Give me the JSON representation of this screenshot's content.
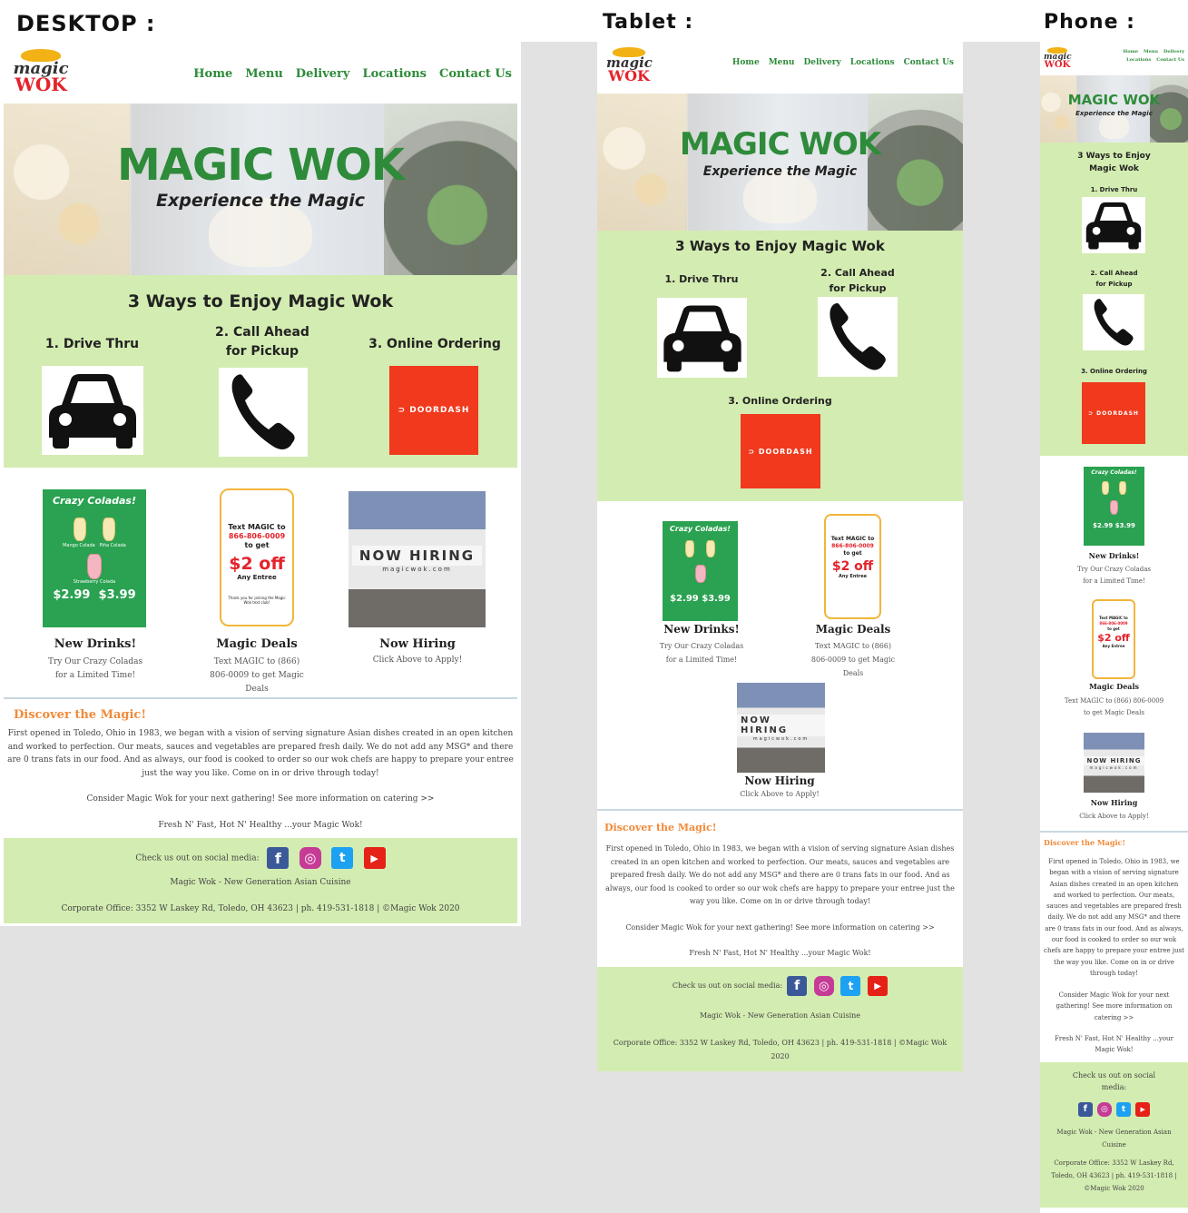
{
  "labels": {
    "desktop": "DESKTOP :",
    "tablet": "Tablet :",
    "phone": "Phone :"
  },
  "brand": {
    "logo_top": "magic",
    "logo_bottom": "WOK",
    "green": "#2e8b3a",
    "red": "#e4232b",
    "orange": "#f08a3a",
    "light_green": "#d3ecb1"
  },
  "nav": [
    "Home",
    "Menu",
    "Delivery",
    "Locations",
    "Contact Us"
  ],
  "hero": {
    "title": "MAGIC WOK",
    "tagline": "Experience the Magic"
  },
  "ways": {
    "title": "3 Ways to Enjoy Magic Wok",
    "w1": "1. Drive Thru",
    "w2a": "2. Call Ahead",
    "w2b": "for Pickup",
    "w3": "3. Online Ordering",
    "doordash": "DOORDASH",
    "car_icon": "car-icon",
    "phone_icon": "phone-icon"
  },
  "promos": {
    "drinks": {
      "art_title": "Crazy Coladas!",
      "art_mango": "Mango Colada",
      "art_pina": "Piña Colada",
      "art_straw": "Strawberry Colada",
      "art_p1": "$2.99",
      "art_p2": "$3.99",
      "title": "New Drinks!",
      "d1": "Try Our Crazy Coladas",
      "d2": "for a Limited Time!"
    },
    "deals": {
      "art1": "Text MAGIC to",
      "art2": "866-806-0009",
      "art3": "to get",
      "art4": "$2 off",
      "art5": "Any Entree",
      "art6": "Thank you for joining the Magic Wok text club!",
      "title": "Magic Deals",
      "d1": "Text MAGIC to (866)",
      "d2": "806-0009 to get Magic",
      "d3": "Deals",
      "d_tab1": "Text MAGIC to (866)",
      "d_tab2": "806-0009 to get Magic",
      "d_tab3": "Deals",
      "d_ph1": "Text MAGIC to (866) 806-0009",
      "d_ph2": "to get Magic Deals"
    },
    "hiring": {
      "art1": "NOW HIRING",
      "art2": "magicwok.com",
      "title": "Now Hiring",
      "d1": "Click Above to Apply!"
    }
  },
  "discover": {
    "title": "Discover the Magic!",
    "p1": "First opened in Toledo, Ohio in 1983, we began with a vision of serving signature Asian dishes created in an open kitchen and worked to perfection. Our meats, sauces and vegetables are prepared fresh daily. We do not add any MSG* and there are 0 trans fats in our food. And as always, our food is cooked to order so our wok chefs are happy to prepare your entree just the way you like. Come on in or drive through today!",
    "p2": "Consider Magic Wok for your next gathering! See more information on catering >>",
    "p3": "Fresh N' Fast, Hot N' Healthy ...your Magic Wok!"
  },
  "footer": {
    "social": "Check us out on social media:",
    "tag": "Magic Wok - New Generation Asian Cuisine",
    "corp": "Corporate Office: 3352 W Laskey Rd, Toledo, OH 43623 | ph. 419-531-1818 | ©Magic Wok 2020",
    "fb": "f",
    "ig": "◎",
    "tw": "t",
    "yt": "▶"
  }
}
